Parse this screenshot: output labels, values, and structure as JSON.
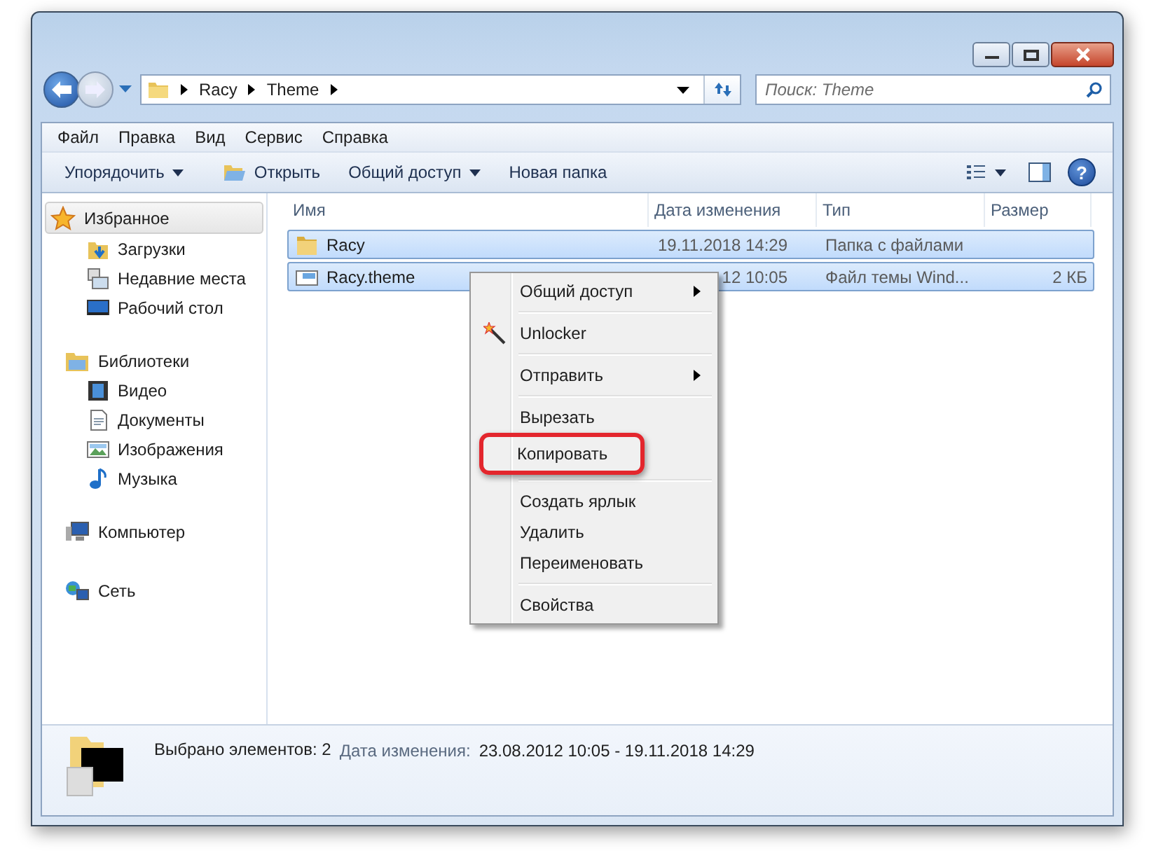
{
  "address": {
    "crumbs": [
      "Racy",
      "Theme"
    ]
  },
  "search": {
    "placeholder": "Поиск: Theme"
  },
  "menu_bar": [
    "Файл",
    "Правка",
    "Вид",
    "Сервис",
    "Справка"
  ],
  "toolbar": [
    {
      "label": "Упорядочить",
      "dropdown": true,
      "kind": "plain"
    },
    {
      "label": "Открыть",
      "dropdown": false,
      "kind": "open"
    },
    {
      "label": "Общий доступ",
      "dropdown": true,
      "kind": "plain"
    },
    {
      "label": "Новая папка",
      "dropdown": false,
      "kind": "plain"
    }
  ],
  "sidebar": [
    {
      "label": "Избранное",
      "kind": "star",
      "selected": true,
      "children": [
        {
          "label": "Загрузки",
          "kind": "downloads"
        },
        {
          "label": "Недавние места",
          "kind": "recent"
        },
        {
          "label": "Рабочий стол",
          "kind": "desktop"
        }
      ]
    },
    {
      "label": "Библиотеки",
      "kind": "libraries",
      "selected": false,
      "children": [
        {
          "label": "Видео",
          "kind": "video"
        },
        {
          "label": "Документы",
          "kind": "docs"
        },
        {
          "label": "Изображения",
          "kind": "images"
        },
        {
          "label": "Музыка",
          "kind": "music"
        }
      ]
    },
    {
      "label": "Компьютер",
      "kind": "computer",
      "selected": false
    },
    {
      "label": "Сеть",
      "kind": "network",
      "selected": false
    }
  ],
  "help_button": "?",
  "table": {
    "columns": [
      "Имя",
      "Дата изменения",
      "Тип",
      "Размер"
    ],
    "rows": [
      {
        "name": "Racy",
        "kind": "folder",
        "date": "19.11.2018 14:29",
        "type": "Папка с файлами",
        "size": "",
        "selected": true
      },
      {
        "name": "Racy.theme",
        "kind": "theme",
        "date": "12 10:05",
        "type": "Файл темы Wind...",
        "size": "2 КБ",
        "selected": true
      }
    ]
  },
  "context_menu": [
    {
      "kind": "item",
      "label": "Общий доступ",
      "submenu": true,
      "icon": false,
      "callout": false
    },
    {
      "kind": "separator"
    },
    {
      "kind": "item",
      "label": "Unlocker",
      "submenu": false,
      "icon": true,
      "callout": false
    },
    {
      "kind": "separator"
    },
    {
      "kind": "item",
      "label": "Отправить",
      "submenu": true,
      "icon": false,
      "callout": false
    },
    {
      "kind": "separator"
    },
    {
      "kind": "item",
      "label": "Вырезать",
      "submenu": false,
      "icon": false,
      "callout": false
    },
    {
      "kind": "item",
      "label": "Копировать",
      "submenu": false,
      "icon": false,
      "callout": true
    },
    {
      "kind": "separator"
    },
    {
      "kind": "item",
      "label": "Создать ярлык",
      "submenu": false,
      "icon": false,
      "callout": false
    },
    {
      "kind": "item",
      "label": "Удалить",
      "submenu": false,
      "icon": false,
      "callout": false
    },
    {
      "kind": "item",
      "label": "Переименовать",
      "submenu": false,
      "icon": false,
      "callout": false
    },
    {
      "kind": "separator"
    },
    {
      "kind": "item",
      "label": "Свойства",
      "submenu": false,
      "icon": false,
      "callout": false
    }
  ],
  "details": {
    "selection": "Выбрано элементов: 2",
    "date_label": "Дата изменения:",
    "date_value": "23.08.2012 10:05 - 19.11.2018 14:29"
  }
}
